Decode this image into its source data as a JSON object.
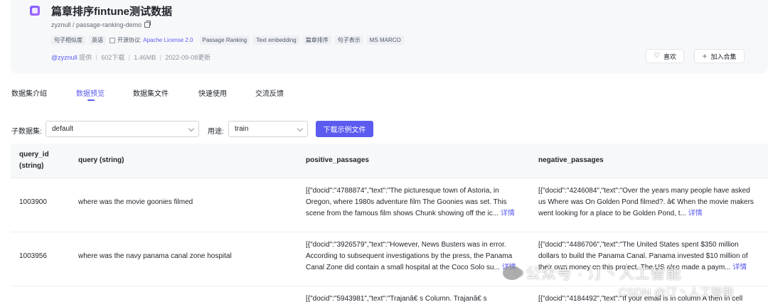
{
  "dataset": {
    "title": "篇章排序fintune测试数据",
    "repo": "zyznull / passage-ranking-demo",
    "tags": [
      "句子相似度",
      "英语"
    ],
    "license_label": "开源协议:",
    "license_value": "Apache License 2.0",
    "tags2": [
      "Passage Ranking",
      "Text embedding",
      "篇章排序",
      "句子表示",
      "MS MARCO"
    ],
    "meta": {
      "author": "@zyznull",
      "provided": "提供",
      "downloads": "602下载",
      "size": "1.46MB",
      "date": "2022-09-08更新"
    },
    "like_label": "喜欢",
    "add_label": "加入合集"
  },
  "tabs": [
    "数据集介绍",
    "数据预览",
    "数据集文件",
    "快速使用",
    "交流反馈"
  ],
  "active_tab": "数据预览",
  "filters": {
    "subset_label": "子数据集:",
    "subset_value": "default",
    "split_label": "用途:",
    "split_value": "train",
    "download_label": "下载示例文件"
  },
  "table": {
    "headers": {
      "query_id_1": "query_id",
      "query_id_2": "(string)",
      "query": "query (string)",
      "positive": "positive_passages",
      "negative": "negative_passages"
    },
    "more_label": "详情",
    "rows": [
      {
        "query_id": "1003900",
        "query": "where was the movie goonies filmed",
        "positive": "[{\"docid\":\"4788874\",\"text\":\"The picturesque town of Astoria, in Oregon, where 1980s adventure film The Goonies was set. This scene from the famous film shows Chunk showing off the ic...",
        "negative": "[{\"docid\":\"4246084\",\"text\":\"Over the years many people have asked us Where was On Golden Pond filmed?. â€  When the movie makers went looking for a place to be Golden Pond, t..."
      },
      {
        "query_id": "1003956",
        "query": "where was the navy panama canal zone hospital",
        "positive": "[{\"docid\":\"3926579\",\"text\":\"However, News Busters was in error. According to subsequent investigations by the press, the Panama Canal Zone did contain a small hospital at the Coco Solo su...",
        "negative": "[{\"docid\":\"4486706\",\"text\":\"The United States spent $350 million dollars to build the Panama Canal. Panama invested $10 million of their own money on this project. The US also made a paym..."
      },
      {
        "query_id": "",
        "query": "",
        "positive": "[{\"docid\":\"5943981\",\"text\":\"Trajanâ€  s Column. Trajanâ€  s",
        "negative": "[{\"docid\":\"4184492\",\"text\":\"If your email is in column A then in cell"
      }
    ]
  },
  "watermarks": {
    "wechat": "公众号 · 汀丶人工智能",
    "csdn": "CSDN @汀丶人工智能"
  }
}
